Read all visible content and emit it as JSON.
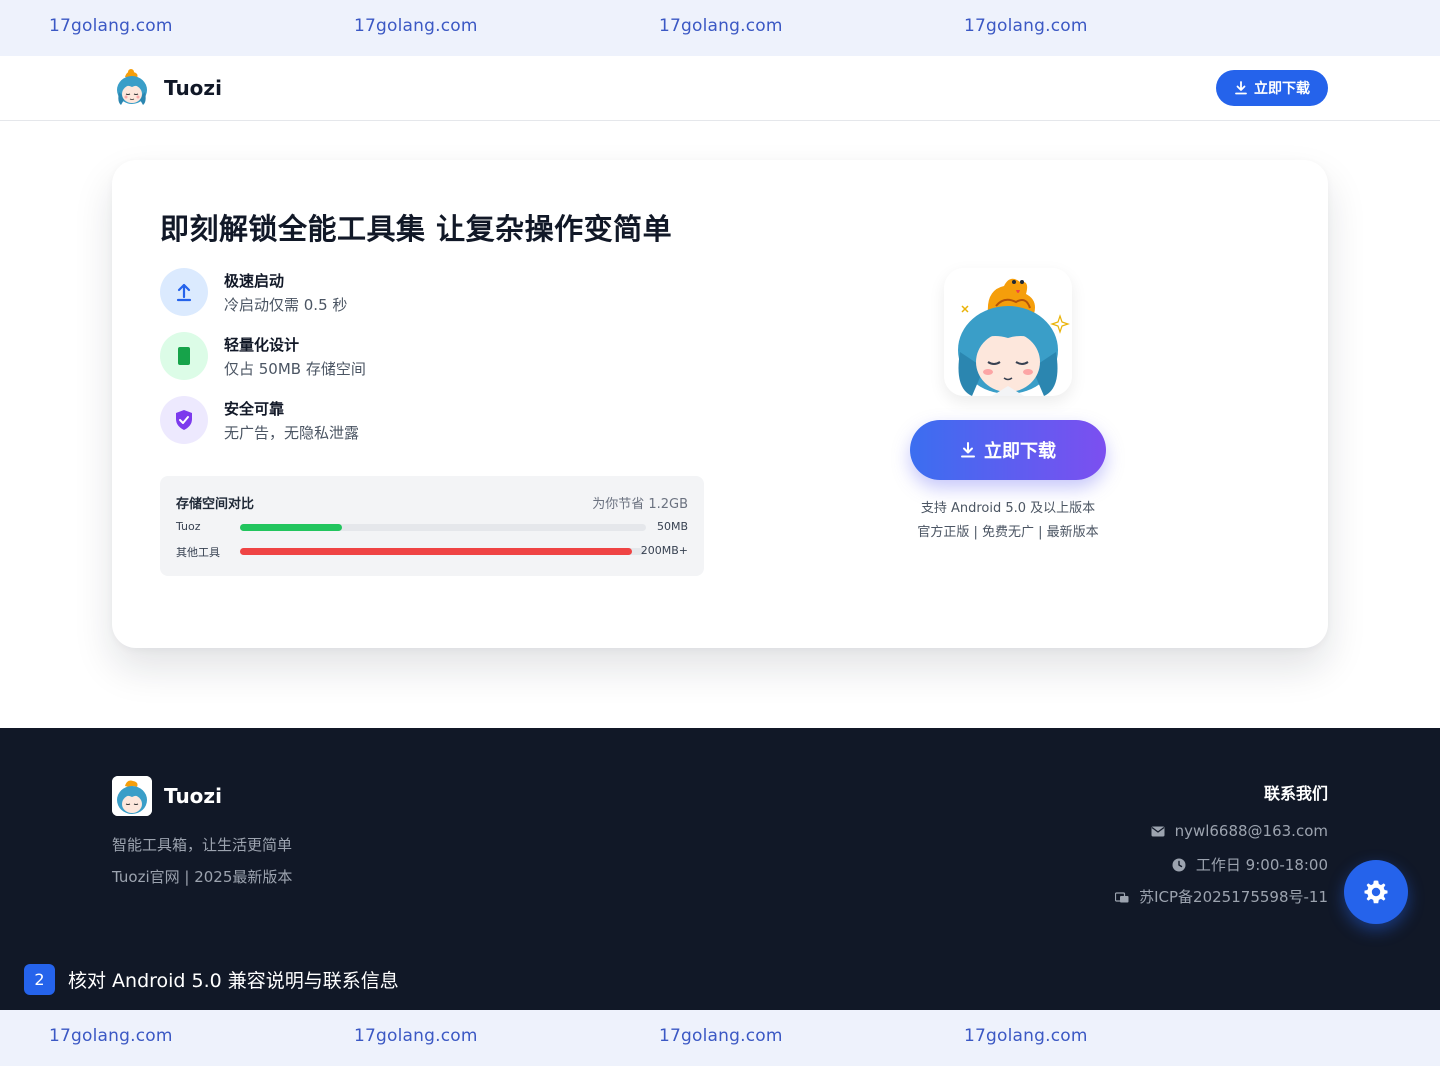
{
  "watermark": {
    "top": [
      "17golang.com",
      "17golang.com",
      "17golang.com",
      "17golang.com"
    ],
    "bottom": [
      "17golang.com",
      "17golang.com",
      "17golang.com",
      "17golang.com"
    ]
  },
  "header": {
    "brand": "Tuozi",
    "download_label": "立即下载"
  },
  "hero": {
    "title": "即刻解锁全能工具集 让复杂操作变简单",
    "features": [
      {
        "title": "极速启动",
        "desc": "冷启动仅需 0.5 秒",
        "icon": "upload-arrow-icon",
        "bg": "#dbeafe",
        "color": "#2563eb"
      },
      {
        "title": "轻量化设计",
        "desc": "仅占 50MB 存储空间",
        "icon": "battery-icon",
        "bg": "#dcfce7",
        "color": "#16a34a"
      },
      {
        "title": "安全可靠",
        "desc": "无广告，无隐私泄露",
        "icon": "shield-check-icon",
        "bg": "#ede9fe",
        "color": "#7c3aed"
      }
    ],
    "storage": {
      "title": "存储空间对比",
      "saving": "为你节省 1.2GB",
      "rows": [
        {
          "label": "Tuoz",
          "value": "50MB",
          "fraction": 0.25,
          "color": "#22c55e"
        },
        {
          "label": "其他工具",
          "value": "200MB+",
          "fraction": 0.965,
          "color": "#ef4444"
        }
      ]
    },
    "download_label": "立即下载",
    "support_line1": "支持 Android 5.0 及以上版本",
    "support_line2": "官方正版 | 免费无广 | 最新版本"
  },
  "footer": {
    "brand": "Tuozi",
    "slogan": "智能工具箱，让生活更简单",
    "edition": "Tuozi官网 | 2025最新版本",
    "contact_title": "联系我们",
    "email": "nywl6688@163.com",
    "hours": "工作日 9:00-18:00",
    "icp": "苏ICP备2025175598号-11"
  },
  "step": {
    "number": "2",
    "text": "核对 Android 5.0 兼容说明与联系信息"
  },
  "colors": {
    "primary": "#2563eb",
    "footer_bg": "#111827",
    "watermark_bg": "#eef2fc"
  }
}
